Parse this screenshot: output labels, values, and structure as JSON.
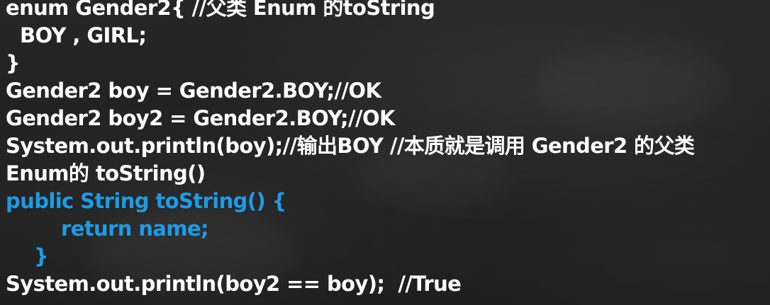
{
  "code_lines": [
    "enum Gender2{ //父类 Enum 的toString",
    "BOY , GIRL;",
    "}",
    "Gender2 boy = Gender2.BOY;//OK",
    "Gender2 boy2 = Gender2.BOY;//OK",
    "System.out.println(boy);//输出BOY //本质就是调用 Gender2 的父类",
    "Enum的 toString()",
    "public String toString() {",
    "return name;",
    "}",
    "System.out.println(boy2 == boy);  //True"
  ],
  "colors": {
    "text": "#ffffff",
    "highlight": "#1d9be6",
    "background": "#1f1f1f"
  }
}
